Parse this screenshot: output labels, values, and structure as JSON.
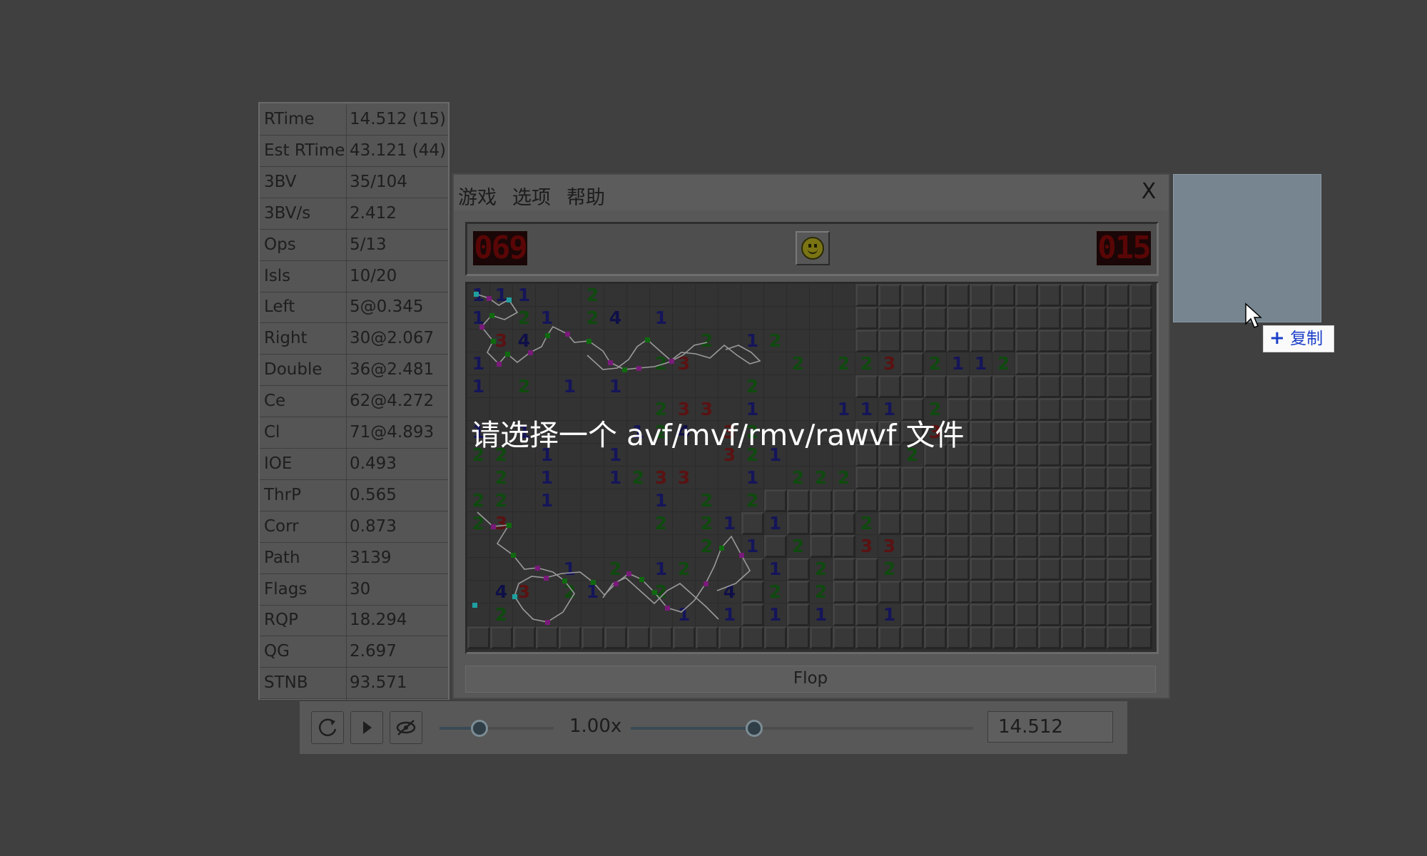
{
  "stats": [
    {
      "key": "RTime",
      "value": "14.512 (15)"
    },
    {
      "key": "Est RTime",
      "value": "43.121 (44)"
    },
    {
      "key": "3BV",
      "value": "35/104"
    },
    {
      "key": "3BV/s",
      "value": "2.412"
    },
    {
      "key": "Ops",
      "value": "5/13"
    },
    {
      "key": "Isls",
      "value": "10/20"
    },
    {
      "key": "Left",
      "value": "5@0.345"
    },
    {
      "key": "Right",
      "value": "30@2.067"
    },
    {
      "key": "Double",
      "value": "36@2.481"
    },
    {
      "key": "Ce",
      "value": "62@4.272"
    },
    {
      "key": "Cl",
      "value": "71@4.893"
    },
    {
      "key": "IOE",
      "value": "0.493"
    },
    {
      "key": "ThrP",
      "value": "0.565"
    },
    {
      "key": "Corr",
      "value": "0.873"
    },
    {
      "key": "Path",
      "value": "3139"
    },
    {
      "key": "Flags",
      "value": "30"
    },
    {
      "key": "RQP",
      "value": "18.294"
    },
    {
      "key": "QG",
      "value": "2.697"
    },
    {
      "key": "STNB",
      "value": "93.571"
    }
  ],
  "menu": {
    "game": "游戏",
    "options": "选项",
    "help": "帮助",
    "close": "X"
  },
  "counters": {
    "mines": "069",
    "timer": "015"
  },
  "overlay_message": "请选择一个 avf/mvf/rmv/rawvf 文件",
  "status": "Flop",
  "playback": {
    "speed": "1.00x",
    "time": "14.512",
    "speed_level": 0.35,
    "progress_level": 0.36
  },
  "copy_tooltip": "复制",
  "icons": {
    "replay": "replay-icon",
    "play": "play-icon",
    "hide": "eye-slash-icon",
    "smiley": "smiley-face-icon",
    "cursor": "mouse-pointer-icon",
    "copy": "plus-icon"
  },
  "colors": {
    "background": "#404040",
    "counter_digits": "#5a0606",
    "tooltip_text": "#1b3ec9",
    "preview": "#768590"
  },
  "board": {
    "cols": 30,
    "rows": 16,
    "grid": [
      "111..2...........................",
      "1.21.24.1........................",
      ".34.......2.12...................",
      "1.......23....2.223.2112.........",
      "1.2.1.1.....2.....................",
      "........233.1...111.2............",
      "1.1....124.32.......3............",
      "22.1..1....321.....2.............",
      ".2.1..1233..1.222................",
      "22.1....1.2.2....................",
      "23......2.21.1...2...............",
      "..........2.1.2..33..............",
      "....1.2.12...1.2..2...............",
      ".43.21..2..4.2.2..................",
      ".2.......1.1.1.1..1..............",
      "................................."
    ]
  }
}
